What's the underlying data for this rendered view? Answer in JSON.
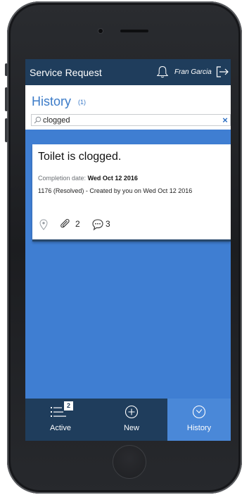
{
  "header": {
    "app_title": "Service Request",
    "user_name": "Fran Garcia",
    "icons": [
      "bell-icon",
      "logout-icon"
    ]
  },
  "history": {
    "title": "History",
    "count": "(1)",
    "search": {
      "value": "clogged",
      "clear_icon": "×"
    }
  },
  "requests": [
    {
      "title": "Toilet is clogged.",
      "completion_label": "Completion date:",
      "completion_date": "Wed Oct 12 2016",
      "meta": "1176 (Resolved) - Created by you on Wed Oct 12 2016",
      "attachments": "2",
      "comments": "3"
    }
  ],
  "tabs": {
    "active": {
      "label": "Active",
      "badge": "2"
    },
    "new": {
      "label": "New"
    },
    "history": {
      "label": "History"
    }
  },
  "colors": {
    "header_bg": "#1f3d5c",
    "content_bg": "#3f7ed2",
    "accent": "#3b7bc8",
    "active_tab_bg": "#4a88d8"
  }
}
